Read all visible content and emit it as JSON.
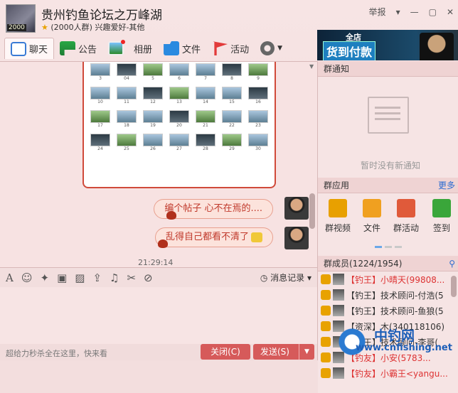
{
  "window": {
    "title": "贵州钓鱼论坛之万峰湖",
    "subtitle_count": "(2000人群)",
    "subtitle_tags": "兴趣爱好-其他",
    "avatar_level": "2000",
    "report": "举报",
    "controls": [
      "▾",
      "—",
      "▢",
      "✕"
    ]
  },
  "banner": {
    "line1": "全店",
    "line2": "货到付款"
  },
  "tabs": [
    {
      "label": "聊天",
      "icon": "chat-icon"
    },
    {
      "label": "公告",
      "icon": "notice-flag-icon"
    },
    {
      "label": "相册",
      "icon": "album-icon"
    },
    {
      "label": "文件",
      "icon": "folder-icon"
    },
    {
      "label": "活动",
      "icon": "activity-flag-icon"
    }
  ],
  "chat": {
    "photo_grid": {
      "numbers": [
        "3",
        "04",
        "5",
        "6",
        "7",
        "8",
        "9",
        "10",
        "11",
        "12",
        "13",
        "14",
        "15",
        "16",
        "17",
        "18",
        "19",
        "20",
        "21",
        "22",
        "23",
        "24",
        "25",
        "26",
        "27",
        "28",
        "29",
        "30"
      ]
    },
    "messages": [
      {
        "text": "编个帖子 心不在焉的...."
      },
      {
        "text": "乱得自己都看不清了"
      }
    ],
    "time": "21:29:14"
  },
  "input_toolbar": {
    "font": "A",
    "emoji": "☺",
    "history_label": "消息记录"
  },
  "bottom": {
    "hint": "超给力秒杀全在这里，快来看",
    "close_label": "关闭(C)",
    "send_label": "发送(S)"
  },
  "right": {
    "notice": {
      "header": "群通知",
      "empty_text": "暂时没有新通知"
    },
    "apps": {
      "header": "群应用",
      "more": "更多",
      "items": [
        {
          "label": "群视频",
          "color": "#e8a000"
        },
        {
          "label": "文件",
          "color": "#f0a020"
        },
        {
          "label": "群活动",
          "color": "#e05a3a"
        },
        {
          "label": "签到",
          "color": "#3aa63a"
        }
      ]
    },
    "members": {
      "header": "群成员(1224/1954)",
      "list": [
        {
          "text": "【钓王】小晴天(99808...",
          "red": true
        },
        {
          "text": "【钓王】技术顾问-付浩(5",
          "red": false
        },
        {
          "text": "【钓王】技术顾问-鱼狼(5",
          "red": false
        },
        {
          "text": "【资深】木(340118106)",
          "red": false
        },
        {
          "text": "【钓王】技术顾问-李哥(",
          "red": false
        },
        {
          "text": "【钓友】小安(5783...",
          "red": true
        },
        {
          "text": "【钓友】小霸王<yangu...",
          "red": true
        }
      ]
    }
  },
  "watermark": {
    "line1": "中钓网",
    "line2": "www.cnfishing.net"
  }
}
